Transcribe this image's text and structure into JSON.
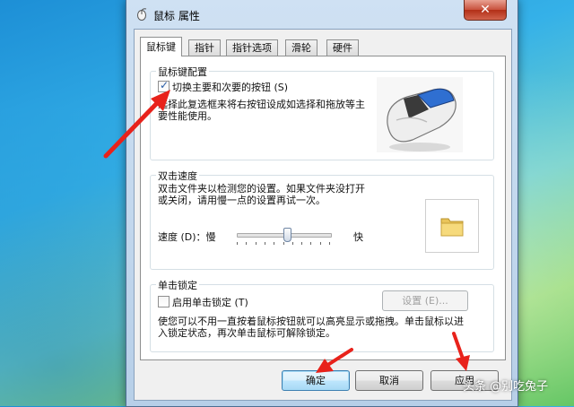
{
  "window": {
    "title": "鼠标 属性",
    "close_label": "✕"
  },
  "tabs": [
    {
      "label": "鼠标键",
      "active": true
    },
    {
      "label": "指针",
      "active": false
    },
    {
      "label": "指针选项",
      "active": false
    },
    {
      "label": "滑轮",
      "active": false
    },
    {
      "label": "硬件",
      "active": false
    }
  ],
  "button_config": {
    "legend": "鼠标键配置",
    "switch_label": "切换主要和次要的按钮 (S)",
    "switch_checked": true,
    "description": "选择此复选框来将右按钮设成如选择和拖放等主要性能使用。"
  },
  "double_click": {
    "legend": "双击速度",
    "description": "双击文件夹以检测您的设置。如果文件夹没打开或关闭，请用慢一点的设置再试一次。",
    "speed_label": "速度 (D)：慢",
    "fast_label": "快",
    "speed_level_percent": 55,
    "test_icon": "folder-icon"
  },
  "click_lock": {
    "legend": "单击锁定",
    "enable_label": "启用单击锁定 (T)",
    "enable_checked": false,
    "settings_label": "设置 (E)...",
    "description": "使您可以不用一直按着鼠标按钮就可以高亮显示或拖拽。单击鼠标以进入锁定状态，再次单击鼠标可解除锁定。"
  },
  "footer": {
    "ok_label": "确定",
    "cancel_label": "取消",
    "apply_label": "应用"
  },
  "watermark": "头条 @别吃兔子",
  "colors": {
    "arrow": "#e8221b",
    "accent": "#3c7fb1"
  }
}
